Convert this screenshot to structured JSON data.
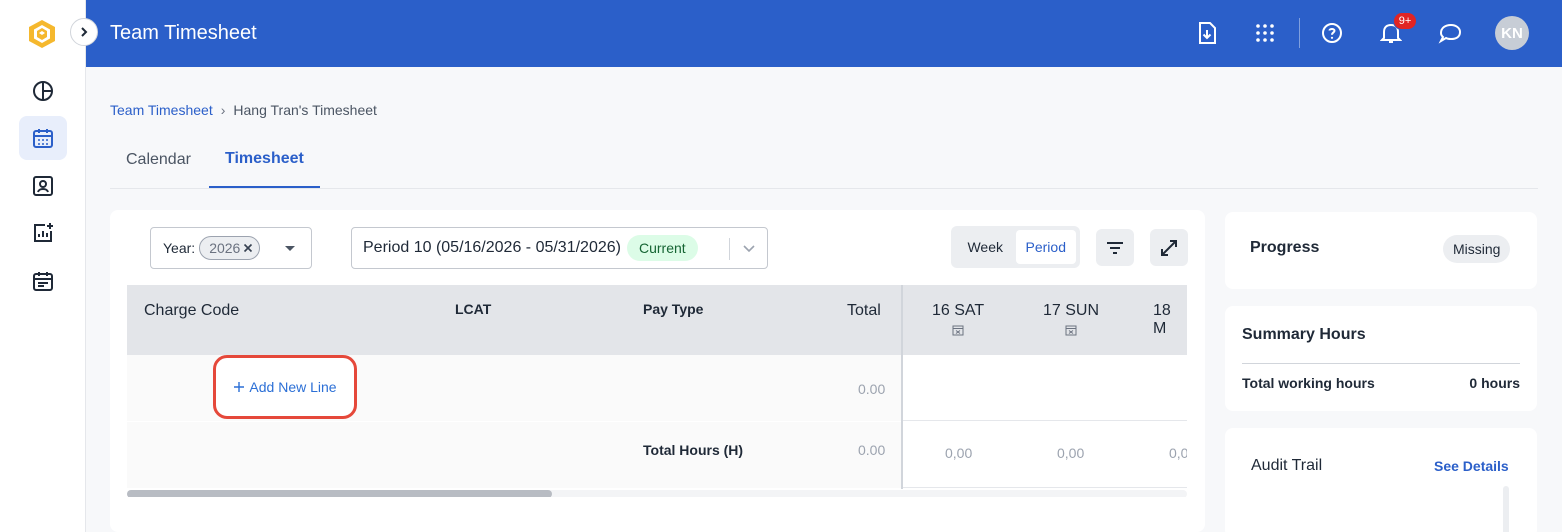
{
  "app": {
    "title": "Team Timesheet"
  },
  "header": {
    "notifications_badge": "9+",
    "avatar_initials": "KN"
  },
  "breadcrumb": {
    "parent": "Team Timesheet",
    "separator": "›",
    "current": "Hang Tran's Timesheet"
  },
  "tabs": [
    {
      "label": "Calendar",
      "active": false
    },
    {
      "label": "Timesheet",
      "active": true
    }
  ],
  "filters": {
    "year_label": "Year:",
    "year_value": "2026",
    "period_value": "Period 10 (05/16/2026 - 05/31/2026)",
    "period_status": "Current",
    "view_toggle": {
      "week": "Week",
      "period": "Period",
      "selected": "Period"
    }
  },
  "grid": {
    "columns": {
      "charge_code": "Charge Code",
      "lcat": "LCAT",
      "pay_type": "Pay Type",
      "total": "Total"
    },
    "days": [
      {
        "label": "16 SAT"
      },
      {
        "label": "17 SUN"
      },
      {
        "label": "18 M"
      }
    ],
    "add_line": "Add New Line",
    "add_line_total": "0.00",
    "total_row": {
      "label": "Total Hours (H)",
      "total": "0.00",
      "day_values": [
        "0,00",
        "0,00",
        "0,0"
      ]
    }
  },
  "progress": {
    "title": "Progress",
    "status": "Missing"
  },
  "summary": {
    "title": "Summary Hours",
    "key": "Total working hours",
    "value": "0 hours"
  },
  "audit": {
    "title": "Audit Trail",
    "link": "See Details"
  },
  "colors": {
    "primary": "#2b5fc9",
    "header_bg": "#2b5fc9",
    "highlight": "#e5483a",
    "current_pill_bg": "#dcfce7",
    "badge": "#e02424"
  }
}
